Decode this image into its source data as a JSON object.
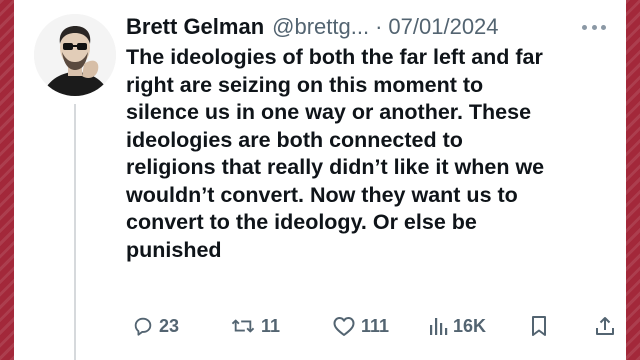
{
  "tweet": {
    "display_name": "Brett Gelman",
    "handle": "@brettg...",
    "separator": "·",
    "date": "07/01/2024",
    "text_lines": [
      "The ideologies of both the far left and far",
      "right are seizing on this moment to",
      "silence us in one way or another. These",
      "ideologies are both connected to",
      "religions that really didn’t like it when we",
      "wouldn’t convert. Now they want us to",
      "convert to the ideology. Or else be",
      "punished"
    ]
  },
  "actions": {
    "replies": "23",
    "reposts": "11",
    "likes": "111",
    "views": "16K"
  },
  "icons": {
    "more": "more-icon",
    "reply": "reply-icon",
    "repost": "repost-icon",
    "like": "heart-icon",
    "views": "analytics-icon",
    "bookmark": "bookmark-icon",
    "share": "share-icon"
  },
  "colors": {
    "strip": "#a3283a",
    "text": "#0f1419",
    "muted": "#536471"
  }
}
